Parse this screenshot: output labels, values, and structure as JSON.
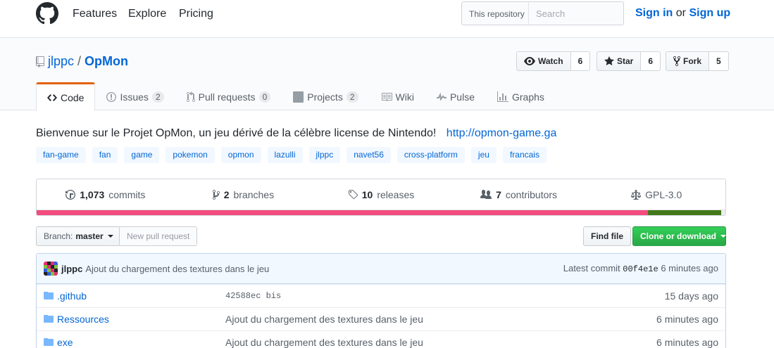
{
  "header": {
    "nav": [
      "Features",
      "Explore",
      "Pricing"
    ],
    "search_scope": "This repository",
    "search_placeholder": "Search",
    "sign_in": "Sign in",
    "or": "or",
    "sign_up": "Sign up"
  },
  "repo": {
    "owner": "jlppc",
    "separator": "/",
    "name": "OpMon",
    "watch_label": "Watch",
    "watch_count": "6",
    "star_label": "Star",
    "star_count": "6",
    "fork_label": "Fork",
    "fork_count": "5"
  },
  "tabs": [
    {
      "label": "Code",
      "icon": "code-icon",
      "counter": ""
    },
    {
      "label": "Issues",
      "icon": "issue-icon",
      "counter": "2"
    },
    {
      "label": "Pull requests",
      "icon": "pull-request-icon",
      "counter": "0"
    },
    {
      "label": "Projects",
      "icon": "project-icon",
      "counter": "2"
    },
    {
      "label": "Wiki",
      "icon": "book-icon",
      "counter": ""
    },
    {
      "label": "Pulse",
      "icon": "pulse-icon",
      "counter": ""
    },
    {
      "label": "Graphs",
      "icon": "graph-icon",
      "counter": ""
    }
  ],
  "description": {
    "text": "Bienvenue sur le Projet OpMon, un jeu dérivé de la célèbre license de Nintendo!",
    "url": "http://opmon-game.ga"
  },
  "topics": [
    "fan-game",
    "fan",
    "game",
    "pokemon",
    "opmon",
    "lazulli",
    "jlppc",
    "navet56",
    "cross-platform",
    "jeu",
    "francais"
  ],
  "summary": {
    "commits_count": "1,073",
    "commits_label": "commits",
    "branches_count": "2",
    "branches_label": "branches",
    "releases_count": "10",
    "releases_label": "releases",
    "contributors_count": "7",
    "contributors_label": "contributors",
    "license": "GPL-3.0"
  },
  "languages": [
    {
      "color": "#f34b7d",
      "percent": 88.8
    },
    {
      "color": "#427819",
      "percent": 10.6
    },
    {
      "color": "#ededed",
      "percent": 0.6
    }
  ],
  "file_nav": {
    "branch_prefix": "Branch:",
    "branch": "master",
    "new_pr": "New pull request",
    "find_file": "Find file",
    "clone": "Clone or download"
  },
  "commit_tease": {
    "author": "jlppc",
    "message": "Ajout du chargement des textures dans le jeu",
    "latest_label": "Latest commit",
    "sha": "00f4e1e",
    "age": "6 minutes ago"
  },
  "files": [
    {
      "name": ".github",
      "message": "42588ec bis",
      "age": "15 days ago",
      "mono": true
    },
    {
      "name": "Ressources",
      "message": "Ajout du chargement des textures dans le jeu",
      "age": "6 minutes ago",
      "mono": false
    },
    {
      "name": "exe",
      "message": "Ajout du chargement des textures dans le jeu",
      "age": "6 minutes ago",
      "mono": false
    }
  ]
}
